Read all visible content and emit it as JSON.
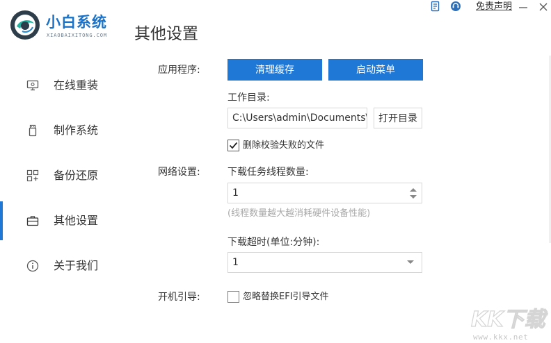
{
  "app": {
    "name": "小白系统",
    "subtitle": "XIAOBAIXITONG.COM",
    "page_title": "其他设置",
    "disclaimer": "免责声明"
  },
  "sidebar": {
    "items": [
      {
        "label": "在线重装",
        "icon": "monitor-icon"
      },
      {
        "label": "制作系统",
        "icon": "usb-drive-icon"
      },
      {
        "label": "备份还原",
        "icon": "backup-grid-icon"
      },
      {
        "label": "其他设置",
        "icon": "briefcase-icon",
        "active": true
      },
      {
        "label": "关于我们",
        "icon": "info-icon"
      }
    ]
  },
  "settings": {
    "app_section": {
      "label": "应用程序:",
      "clear_cache_label": "清理缓存",
      "startup_menu_label": "启动菜单",
      "workdir_label": "工作目录:",
      "workdir_value": "C:\\Users\\admin\\Documents\\Xia",
      "open_dir_label": "打开目录",
      "delete_failed_label": "删除校验失败的文件",
      "delete_failed_checked": true
    },
    "network_section": {
      "label": "网络设置:",
      "threads_label": "下载任务线程数量:",
      "threads_value": "1",
      "threads_hint": "(线程数量越大越消耗硬件设备性能)",
      "timeout_label": "下载超时(单位:分钟):",
      "timeout_value": "1"
    },
    "boot_section": {
      "label": "开机引导:",
      "ignore_efi_label": "忽略替换EFI引导文件",
      "ignore_efi_checked": false
    }
  },
  "watermark": {
    "logo_text": "KK下载",
    "url": "www.kkx.net"
  },
  "colors": {
    "accent": "#1f77d6",
    "brand": "#1a73c8"
  }
}
